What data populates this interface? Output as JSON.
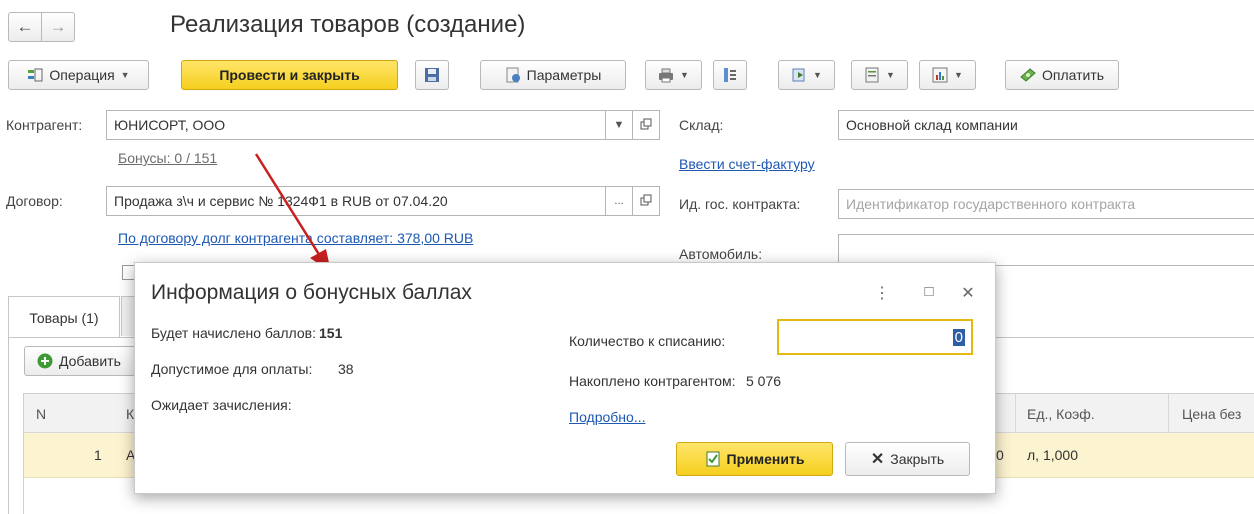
{
  "window": {
    "title": "Реализация товаров (создание)",
    "nav_back": "←",
    "nav_forward": "→"
  },
  "toolbar": {
    "operation_label": "Операция",
    "post_close_label": "Провести и закрыть",
    "params_label": "Параметры",
    "pay_label": "Оплатить"
  },
  "form": {
    "counterparty_label": "Контрагент:",
    "counterparty_value": "ЮНИСОРТ, ООО",
    "bonuses_link": "Бонусы: 0 / 151",
    "warehouse_label": "Склад:",
    "warehouse_value": "Основной склад компании",
    "invoice_link": "Ввести счет-фактуру",
    "contract_label": "Договор:",
    "contract_value": "Продажа з\\ч и сервис № 1324Ф1 в RUB от 07.04.20",
    "contract_ellipsis": "...",
    "gov_contract_label": "Ид. гос. контракта:",
    "gov_contract_placeholder": "Идентификатор государственного контракта",
    "debt_link": "По договору долг контрагента составляет: 378,00 RUB",
    "car_label": "Автомобиль:"
  },
  "tabs": {
    "goods_label": "Товары (1)"
  },
  "table": {
    "add_button_label": "Добавить",
    "col_n": "N",
    "col_k": "К",
    "col_unit": "Ед., Коэф.",
    "col_price": "Цена без",
    "row1_n": "1",
    "row1_k": "А",
    "row1_unit": "л, 1,000",
    "row1_partial": "0"
  },
  "dialog": {
    "title": "Информация о бонусных баллах",
    "will_accrue_label": "Будет начислено баллов:",
    "will_accrue_value": "151",
    "allowed_label": "Допустимое для оплаты:",
    "allowed_value": "38",
    "pending_label": "Ожидает зачисления:",
    "writeoff_label": "Количество к списанию:",
    "writeoff_value": "0",
    "accumulated_label": "Накоплено контрагентом:",
    "accumulated_value": "5 076",
    "details_link": "Подробно...",
    "apply_label": "Применить",
    "close_label": "Закрыть",
    "menu_glyph": "⋮",
    "maximize_glyph": "□",
    "close_glyph": "✕"
  },
  "colors": {
    "accent_yellow": "#f5cf1e",
    "link_blue": "#1d58b3",
    "arrow_red": "#c8201e",
    "row_highlight": "#fcf3d0",
    "focus_border": "#e3b912"
  }
}
